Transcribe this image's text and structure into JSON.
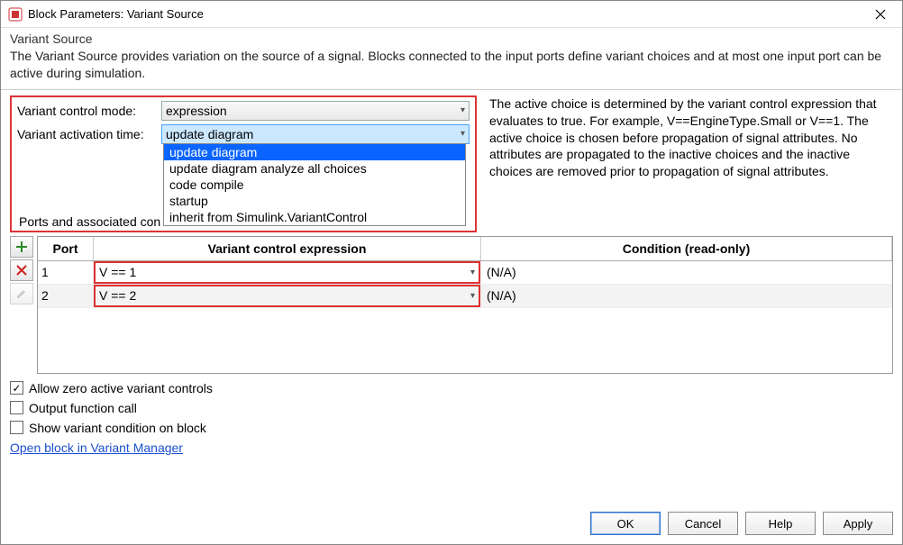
{
  "titlebar": {
    "title": "Block Parameters: Variant Source"
  },
  "header": {
    "subtitle": "Variant Source",
    "description": "The Variant Source provides variation on the source of a signal. Blocks connected to the input ports define variant choices and at most one input port can be active during simulation."
  },
  "controls": {
    "mode_label": "Variant control mode:",
    "mode_value": "expression",
    "activation_label": "Variant activation time:",
    "activation_value": "update diagram",
    "activation_options": [
      "update diagram",
      "update diagram analyze all choices",
      "code compile",
      "startup",
      "inherit from Simulink.VariantControl"
    ],
    "ports_label_prefix": "Ports and associated con"
  },
  "side_help": "The active choice is determined by the variant control expression that evaluates to true. For example, V==EngineType.Small or V==1. The active choice is chosen before propagation of signal attributes. No attributes are propagated to the inactive choices and the inactive choices are removed prior to propagation of signal attributes.",
  "table": {
    "headers": {
      "port": "Port",
      "expr": "Variant control expression",
      "cond": "Condition (read-only)"
    },
    "rows": [
      {
        "port": "1",
        "expr": "V == 1",
        "cond": "(N/A)"
      },
      {
        "port": "2",
        "expr": "V == 2",
        "cond": "(N/A)"
      }
    ]
  },
  "checkboxes": {
    "allow_zero": {
      "label": "Allow zero active variant controls",
      "checked": true
    },
    "output_fcn": {
      "label": "Output function call",
      "checked": false
    },
    "show_cond": {
      "label": "Show variant condition on block",
      "checked": false
    }
  },
  "link_text": "Open block in Variant Manager",
  "buttons": {
    "ok": "OK",
    "cancel": "Cancel",
    "help": "Help",
    "apply": "Apply"
  }
}
